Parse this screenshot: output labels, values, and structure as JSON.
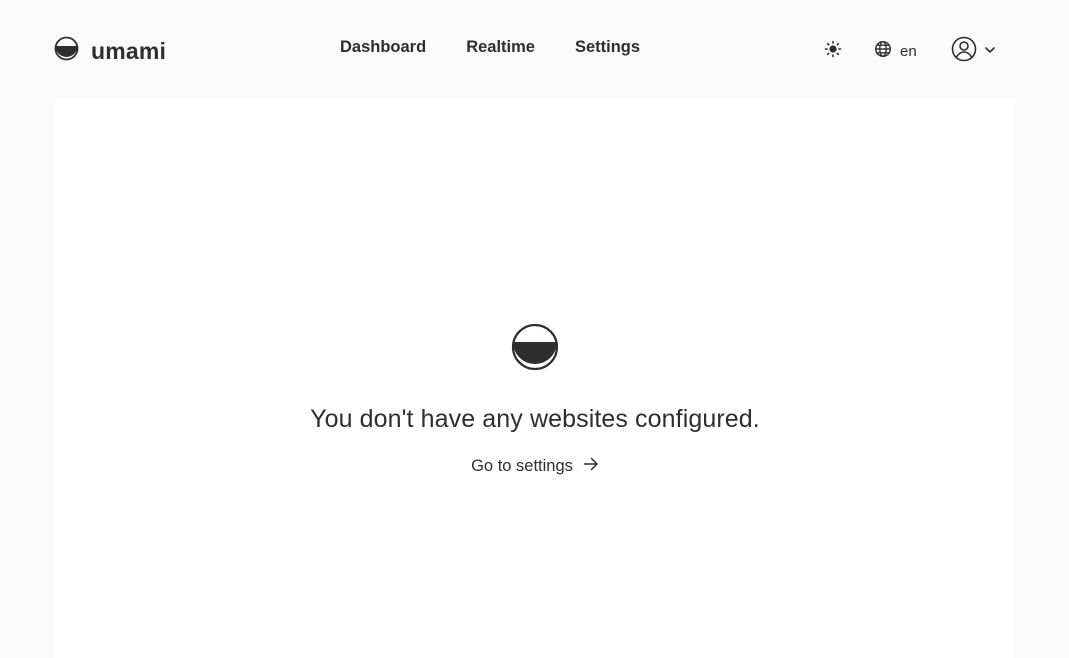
{
  "brand": {
    "name": "umami"
  },
  "nav": {
    "items": [
      "Dashboard",
      "Realtime",
      "Settings"
    ]
  },
  "toolbar": {
    "language": "en",
    "theme_icon": "sun-icon",
    "language_icon": "globe-icon",
    "user_icon": "user-circle-icon"
  },
  "empty_state": {
    "message": "You don't have any websites configured.",
    "link_label": "Go to settings"
  },
  "colors": {
    "text": "#2e2e2e",
    "page_bg": "#fafafa",
    "card_bg": "#ffffff"
  }
}
